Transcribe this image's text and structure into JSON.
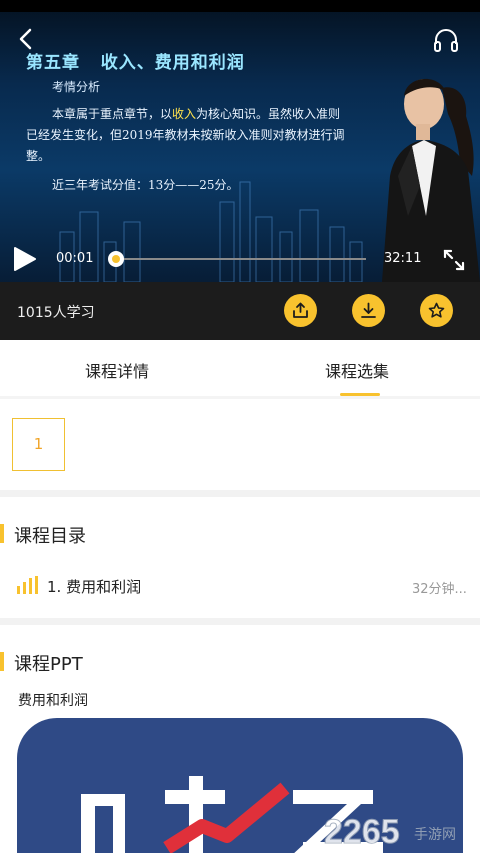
{
  "player": {
    "slide": {
      "title": "第五章   收入、费用和利润",
      "subtitle": "考情分析",
      "body_pre": "本章属于重点章节，以",
      "body_highlight": "收入",
      "body_post": "为核心知识。虽然收入准则已经发生变化，但2019年教材未按新收入准则对教材进行调整。",
      "score": "近三年考试分值：13分——25分。"
    },
    "current_time": "00:01",
    "total_time": "32:11",
    "progress": 0.0005,
    "back_icon": "chevron-left-icon",
    "audio_icon": "headphone-icon",
    "play_icon": "play-icon",
    "fullscreen_icon": "expand-icon"
  },
  "info_bar": {
    "learners": "1015人学习",
    "actions": [
      {
        "icon": "share-icon"
      },
      {
        "icon": "download-icon"
      },
      {
        "icon": "star-icon"
      }
    ]
  },
  "tabs": [
    {
      "label": "课程详情",
      "active": false
    },
    {
      "label": "课程选集",
      "active": true
    }
  ],
  "episodes": [
    "1"
  ],
  "catalog": {
    "title": "课程目录",
    "lessons": [
      {
        "title": "1. 费用和利润",
        "duration": "32分钟..."
      }
    ]
  },
  "ppt": {
    "title": "课程PPT",
    "name": "费用和利润"
  },
  "watermark": {
    "number": "2265",
    "suffix": "手游网"
  },
  "colors": {
    "accent": "#f8c22e",
    "info_bar": "#1c1c1c",
    "ppt_bg": "#2f4a86"
  }
}
